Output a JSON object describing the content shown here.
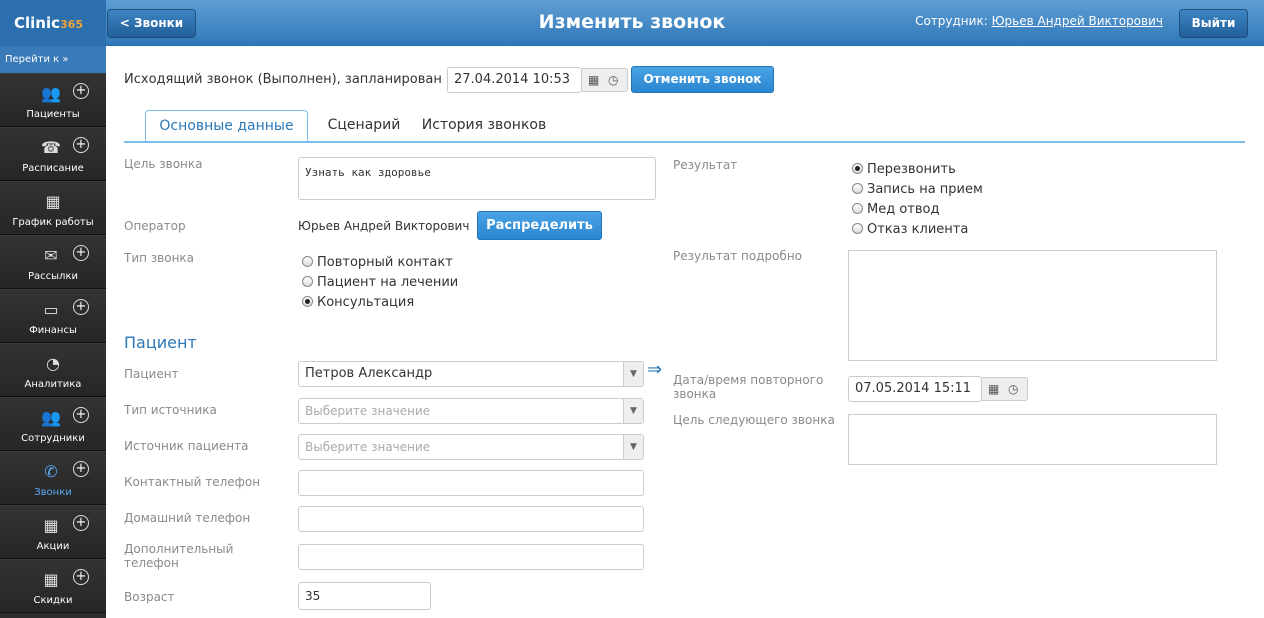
{
  "header": {
    "logo_text": "Clinic",
    "logo_num": "365",
    "back_label": "< Звонки",
    "title": "Изменить звонок",
    "employee_label": "Сотрудник:",
    "employee_name": "Юрьев Андрей Викторович",
    "exit_label": "Выйти"
  },
  "sidebar": {
    "goto_label": "Перейти к »",
    "items": [
      {
        "label": "Пациенты",
        "icon": "patients-icon",
        "plus": true
      },
      {
        "label": "Расписание",
        "icon": "schedule-icon",
        "plus": true
      },
      {
        "label": "График работы",
        "icon": "calendar-icon",
        "plus": false
      },
      {
        "label": "Рассылки",
        "icon": "mail-icon",
        "plus": true
      },
      {
        "label": "Финансы",
        "icon": "money-icon",
        "plus": true
      },
      {
        "label": "Аналитика",
        "icon": "chart-icon",
        "plus": false
      },
      {
        "label": "Сотрудники",
        "icon": "staff-icon",
        "plus": true
      },
      {
        "label": "Звонки",
        "icon": "phone-icon",
        "plus": true,
        "active": true
      },
      {
        "label": "Акции",
        "icon": "calendar-icon",
        "plus": true
      },
      {
        "label": "Скидки",
        "icon": "calendar-icon",
        "plus": true
      }
    ]
  },
  "call": {
    "status_text": "Исходящий звонок (Выполнен), запланирован на",
    "scheduled": "27.04.2014 10:53",
    "cancel_label": "Отменить звонок"
  },
  "tabs": [
    "Основные данные",
    "Сценарий",
    "История звонков"
  ],
  "form": {
    "goal_label": "Цель звонка",
    "goal_value": "Узнать как здоровье",
    "operator_label": "Оператор",
    "operator_value": "Юрьев Андрей Викторович",
    "assign_label": "Распределить",
    "calltype_label": "Тип звонка",
    "calltype_options": [
      "Повторный контакт",
      "Пациент на лечении",
      "Консультация"
    ],
    "calltype_selected": 2,
    "patient_section": "Пациент",
    "patient_label": "Пациент",
    "patient_value": "Петров Александр",
    "source_type_label": "Тип источника",
    "source_type_placeholder": "Выберите значение",
    "source_label": "Источник пациента",
    "source_placeholder": "Выберите значение",
    "contact_phone_label": "Контактный телефон",
    "home_phone_label": "Домашний телефон",
    "extra_phone_label": "Дополнительный телефон",
    "age_label": "Возраст",
    "age_value": "35",
    "result_label": "Результат",
    "result_options": [
      "Перезвонить",
      "Запись на прием",
      "Мед отвод",
      "Отказ клиента"
    ],
    "result_selected": 0,
    "result_detail_label": "Результат подробно",
    "next_dt_label": "Дата/время повторного звонка",
    "next_dt_value": "07.05.2014 15:11",
    "next_goal_label": "Цель следующего звонка"
  }
}
